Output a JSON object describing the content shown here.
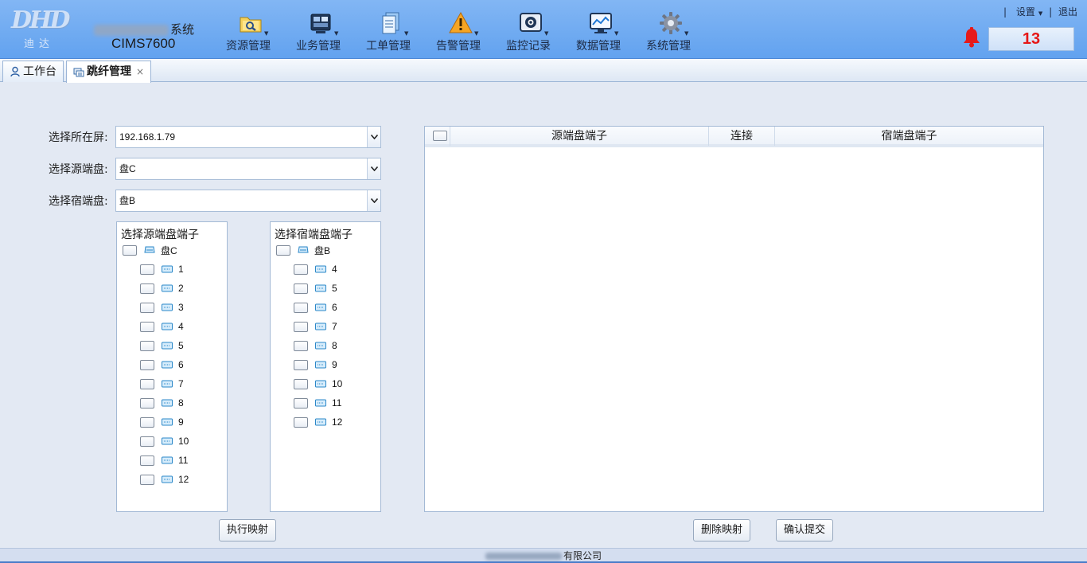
{
  "header": {
    "logo_main": "DHD",
    "logo_sub": "迪达",
    "system_suffix": "系统",
    "system_code": "CIMS7600",
    "nav": [
      {
        "label": "资源管理",
        "icon": "folder-search-icon"
      },
      {
        "label": "业务管理",
        "icon": "business-icon"
      },
      {
        "label": "工单管理",
        "icon": "work-order-icon"
      },
      {
        "label": "告警管理",
        "icon": "warning-icon"
      },
      {
        "label": "监控记录",
        "icon": "monitor-eye-icon"
      },
      {
        "label": "数据管理",
        "icon": "chart-monitor-icon"
      },
      {
        "label": "系统管理",
        "icon": "gear-icon"
      }
    ],
    "sep": "|",
    "settings": "设置",
    "logout": "退出",
    "alarm_count": "13"
  },
  "tabs": [
    {
      "label": "工作台"
    },
    {
      "label": "跳纤管理",
      "close": "×"
    }
  ],
  "form": {
    "screen_label": "选择所在屏:",
    "screen_value": "192.168.1.79",
    "source_label": "选择源端盘:",
    "source_value": "盘C",
    "dest_label": "选择宿端盘:",
    "dest_value": "盘B"
  },
  "source_tree": {
    "title": "选择源端盘端子",
    "root": "盘C",
    "ports": [
      "1",
      "2",
      "3",
      "4",
      "5",
      "6",
      "7",
      "8",
      "9",
      "10",
      "11",
      "12"
    ]
  },
  "dest_tree": {
    "title": "选择宿端盘端子",
    "root": "盘B",
    "ports": [
      "4",
      "5",
      "6",
      "7",
      "8",
      "9",
      "10",
      "11",
      "12"
    ]
  },
  "buttons": {
    "execute": "执行映射",
    "delete": "删除映射",
    "confirm": "确认提交"
  },
  "grid": {
    "col_source": "源端盘端子",
    "col_link": "连接",
    "col_dest": "宿端盘端子"
  },
  "footer": {
    "company_suffix": "有限公司"
  }
}
